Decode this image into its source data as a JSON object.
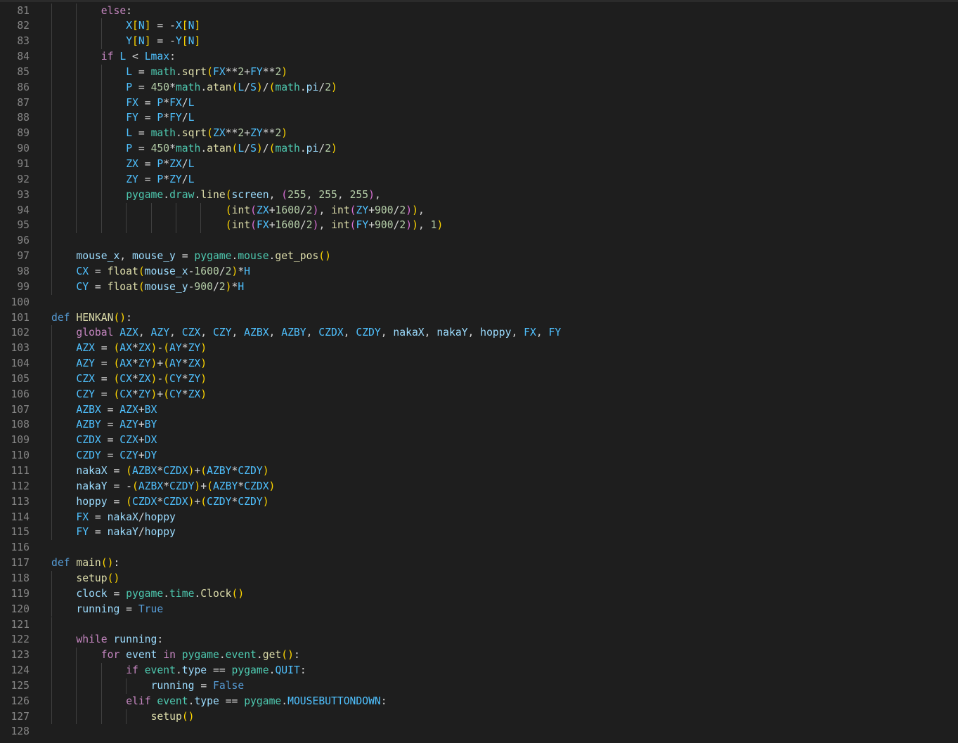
{
  "editor": {
    "language": "python",
    "theme_colors": {
      "background": "#1e1e1e",
      "line_number": "#858585",
      "keyword": "#c586c0",
      "def": "#569cd6",
      "function": "#dcdcaa",
      "variable": "#9cdcfe",
      "constant": "#4fc1ff",
      "number": "#b5cea8",
      "bracket_level_1": "#ffd700",
      "bracket_level_2": "#da70d6",
      "bracket_level_3": "#179fff",
      "module": "#4ec9b0"
    },
    "lines": [
      {
        "n": "81",
        "indent": 2,
        "text": "else:"
      },
      {
        "n": "82",
        "indent": 3,
        "text": "X[N] = -X[N]"
      },
      {
        "n": "83",
        "indent": 3,
        "text": "Y[N] = -Y[N]"
      },
      {
        "n": "84",
        "indent": 2,
        "text": "if L < Lmax:"
      },
      {
        "n": "85",
        "indent": 3,
        "text": "L = math.sqrt(FX**2+FY**2)"
      },
      {
        "n": "86",
        "indent": 3,
        "text": "P = 450*math.atan(L/S)/(math.pi/2)"
      },
      {
        "n": "87",
        "indent": 3,
        "text": "FX = P*FX/L"
      },
      {
        "n": "88",
        "indent": 3,
        "text": "FY = P*FY/L"
      },
      {
        "n": "89",
        "indent": 3,
        "text": "L = math.sqrt(ZX**2+ZY**2)"
      },
      {
        "n": "90",
        "indent": 3,
        "text": "P = 450*math.atan(L/S)/(math.pi/2)"
      },
      {
        "n": "91",
        "indent": 3,
        "text": "ZX = P*ZX/L"
      },
      {
        "n": "92",
        "indent": 3,
        "text": "ZY = P*ZY/L"
      },
      {
        "n": "93",
        "indent": 3,
        "text": "pygame.draw.line(screen, (255, 255, 255),"
      },
      {
        "n": "94",
        "indent": 7,
        "text": "(int(ZX+1600/2), int(ZY+900/2)),"
      },
      {
        "n": "95",
        "indent": 7,
        "text": "(int(FX+1600/2), int(FY+900/2)), 1)"
      },
      {
        "n": "96",
        "indent": 0,
        "text": ""
      },
      {
        "n": "97",
        "indent": 1,
        "text": "mouse_x, mouse_y = pygame.mouse.get_pos()"
      },
      {
        "n": "98",
        "indent": 1,
        "text": "CX = float(mouse_x-1600/2)*H"
      },
      {
        "n": "99",
        "indent": 1,
        "text": "CY = float(mouse_y-900/2)*H"
      },
      {
        "n": "100",
        "indent": 0,
        "text": ""
      },
      {
        "n": "101",
        "indent": 0,
        "text": "def HENKAN():"
      },
      {
        "n": "102",
        "indent": 1,
        "text": "global AZX, AZY, CZX, CZY, AZBX, AZBY, CZDX, CZDY, nakaX, nakaY, hoppy, FX, FY"
      },
      {
        "n": "103",
        "indent": 1,
        "text": "AZX = (AX*ZX)-(AY*ZY)"
      },
      {
        "n": "104",
        "indent": 1,
        "text": "AZY = (AX*ZY)+(AY*ZX)"
      },
      {
        "n": "105",
        "indent": 1,
        "text": "CZX = (CX*ZX)-(CY*ZY)"
      },
      {
        "n": "106",
        "indent": 1,
        "text": "CZY = (CX*ZY)+(CY*ZX)"
      },
      {
        "n": "107",
        "indent": 1,
        "text": "AZBX = AZX+BX"
      },
      {
        "n": "108",
        "indent": 1,
        "text": "AZBY = AZY+BY"
      },
      {
        "n": "109",
        "indent": 1,
        "text": "CZDX = CZX+DX"
      },
      {
        "n": "110",
        "indent": 1,
        "text": "CZDY = CZY+DY"
      },
      {
        "n": "111",
        "indent": 1,
        "text": "nakaX = (AZBX*CZDX)+(AZBY*CZDY)"
      },
      {
        "n": "112",
        "indent": 1,
        "text": "nakaY = -(AZBX*CZDY)+(AZBY*CZDX)"
      },
      {
        "n": "113",
        "indent": 1,
        "text": "hoppy = (CZDX*CZDX)+(CZDY*CZDY)"
      },
      {
        "n": "114",
        "indent": 1,
        "text": "FX = nakaX/hoppy"
      },
      {
        "n": "115",
        "indent": 1,
        "text": "FY = nakaY/hoppy"
      },
      {
        "n": "116",
        "indent": 0,
        "text": ""
      },
      {
        "n": "117",
        "indent": 0,
        "text": "def main():"
      },
      {
        "n": "118",
        "indent": 1,
        "text": "setup()"
      },
      {
        "n": "119",
        "indent": 1,
        "text": "clock = pygame.time.Clock()"
      },
      {
        "n": "120",
        "indent": 1,
        "text": "running = True"
      },
      {
        "n": "121",
        "indent": 0,
        "text": ""
      },
      {
        "n": "122",
        "indent": 1,
        "text": "while running:"
      },
      {
        "n": "123",
        "indent": 2,
        "text": "for event in pygame.event.get():"
      },
      {
        "n": "124",
        "indent": 3,
        "text": "if event.type == pygame.QUIT:"
      },
      {
        "n": "125",
        "indent": 4,
        "text": "running = False"
      },
      {
        "n": "126",
        "indent": 3,
        "text": "elif event.type == pygame.MOUSEBUTTONDOWN:"
      },
      {
        "n": "127",
        "indent": 4,
        "text": "setup()"
      },
      {
        "n": "128",
        "indent": 0,
        "text": ""
      }
    ]
  }
}
